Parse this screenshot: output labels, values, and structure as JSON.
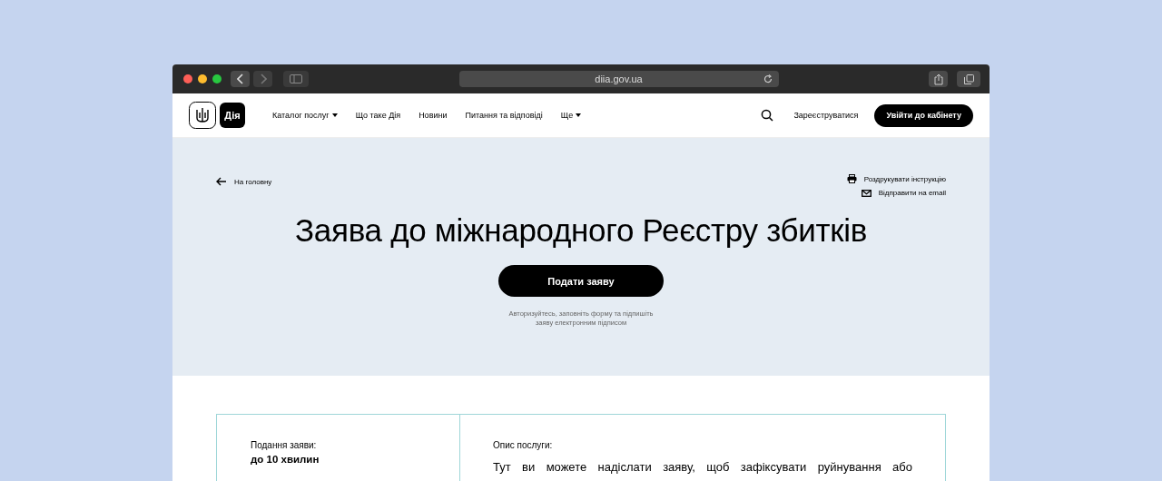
{
  "browser": {
    "address": "diia.gov.ua"
  },
  "header": {
    "logo_text": "Дія",
    "nav": [
      {
        "label": "Каталог послуг",
        "dropdown": true
      },
      {
        "label": "Що таке Дія",
        "dropdown": false
      },
      {
        "label": "Новини",
        "dropdown": false
      },
      {
        "label": "Питання та відповіді",
        "dropdown": false
      },
      {
        "label": "Ще",
        "dropdown": true
      }
    ],
    "register": "Зареєструватися",
    "login": "Увійти до кабінету"
  },
  "hero": {
    "back": "На головну",
    "actions": [
      {
        "kind": "print",
        "label": "Роздрукувати інструкцію"
      },
      {
        "kind": "email",
        "label": "Відправити на email"
      }
    ],
    "title": "Заява до міжнародного Реєстру збитків",
    "submit": "Подати заяву",
    "hint": "Авторизуйтесь, заповніть форму та підпишіть заяву електронним підписом"
  },
  "info": {
    "duration_label": "Подання заяви:",
    "duration": "до 10 хвилин",
    "description_label": "Опис послуги:",
    "description": "Тут ви можете надіслати заяву, щоб зафіксувати руйнування або"
  }
}
